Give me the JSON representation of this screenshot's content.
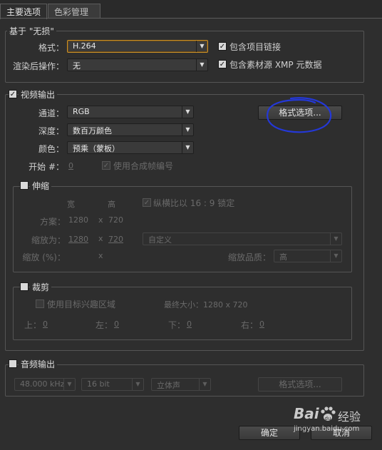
{
  "tabs": [
    "主要选项",
    "色彩管理"
  ],
  "base": {
    "title": "基于 \"无损\"",
    "format_label": "格式：",
    "format_value": "H.264",
    "post_render_label": "渲染后操作：",
    "post_render_value": "无",
    "include_project_link": "包含项目链接",
    "include_xmp": "包含素材源 XMP 元数据"
  },
  "video": {
    "title": "视频输出",
    "channel_label": "通道：",
    "channel_value": "RGB",
    "depth_label": "深度：",
    "depth_value": "数百万颜色",
    "color_label": "颜色：",
    "color_value": "预乘（蒙板）",
    "start_label": "开始 #：",
    "start_value": "0",
    "use_comp_frame": "使用合成帧编号",
    "format_options_btn": "格式选项..."
  },
  "resize": {
    "title": "伸缩",
    "width_header": "宽",
    "height_header": "高",
    "lock_aspect": "纵横比以 16 : 9 锁定",
    "rendering_label": "方案：",
    "rendering_w": "1280",
    "rendering_h": "720",
    "resize_to_label": "缩放为：",
    "resize_w": "1280",
    "resize_h": "720",
    "preset_value": "自定义",
    "resize_pct_label": "缩放 (%)：",
    "x": "x",
    "quality_label": "缩放品质：",
    "quality_value": "高"
  },
  "crop": {
    "title": "裁剪",
    "use_roi": "使用目标兴趣区域",
    "final_size": "最终大小：1280 x 720",
    "top_label": "上：",
    "top_value": "0",
    "left_label": "左：",
    "left_value": "0",
    "bottom_label": "下：",
    "bottom_value": "0",
    "right_label": "右：",
    "right_value": "0"
  },
  "audio": {
    "title": "音频输出",
    "rate_value": "48.000 kHz",
    "bits_value": "16 bit",
    "channels_value": "立体声",
    "format_options_btn": "格式选项..."
  },
  "footer": {
    "ok": "确定",
    "cancel": "取消"
  },
  "watermark": {
    "brand": "Bai",
    "paw": "du",
    "jingyan": "经验",
    "url": "jingyan.baidu.com"
  },
  "colors": {
    "annotation_circle": "#2438d8",
    "focus_border": "#c8902a"
  },
  "icons": [
    "check-icon",
    "chevron-down-icon",
    "baidu-paw-icon"
  ]
}
